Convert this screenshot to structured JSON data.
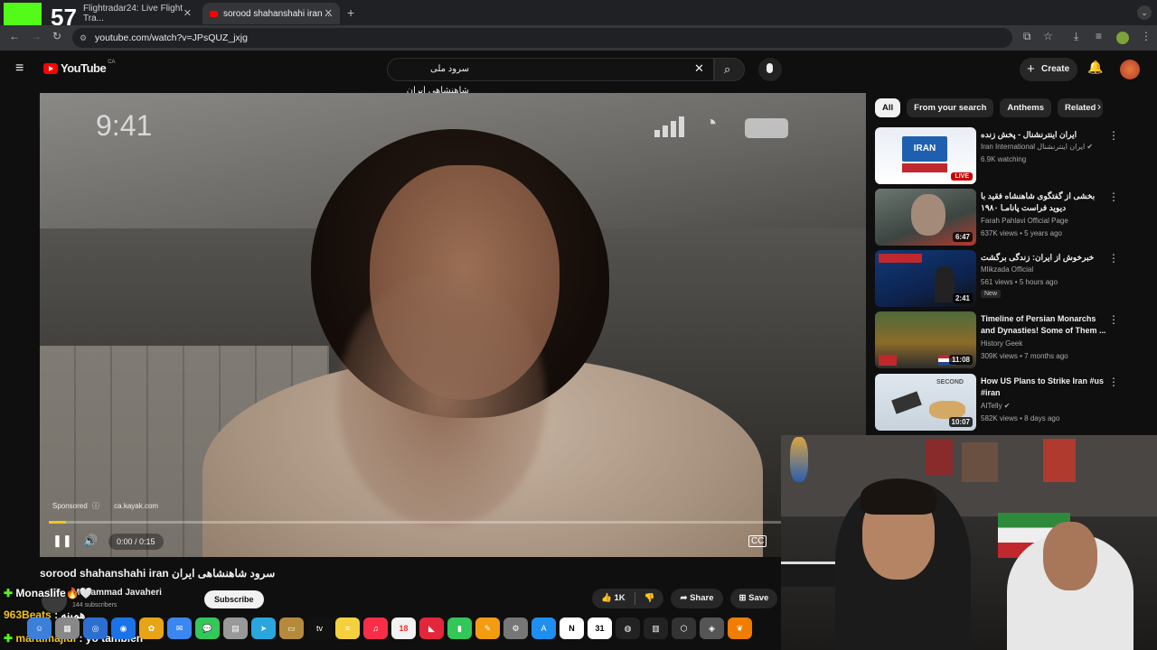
{
  "browser": {
    "tabs": [
      {
        "label": "Flightradar24: Live Flight Tra...",
        "active": false
      },
      {
        "label": "sorood shahanshahi iran ...",
        "active": true
      }
    ],
    "url": "youtube.com/watch?v=JPsQUZ_jxjg"
  },
  "youtube": {
    "logo_text": "YouTube",
    "country_code": "CA",
    "search_query": "سرود ملی شاهنشاهی ایران",
    "create_label": "Create"
  },
  "video": {
    "overlay_clock": "9:41",
    "sponsored_label": "Sponsored",
    "sponsor_domain": "ca.kayak.com",
    "time_display": "0:00 / 0:15",
    "progress_fraction": 0.022,
    "title": "sorood shahanshahi iran سرود شاهنشاهی ایران",
    "channel_name": "Mohammad Javaheri",
    "subscribers": "144 subscribers",
    "subscribe_label": "Subscribe",
    "like_count": "1K",
    "share_label": "Share",
    "save_label": "Save"
  },
  "chips": [
    "All",
    "From your search",
    "Anthems",
    "Related"
  ],
  "recommendations": [
    {
      "title": "ایران اینترنشنال - پخش زنده",
      "channel": "Iran International ایران اینترنشنال",
      "meta": "6.9K watching",
      "badge": "LIVE",
      "verified": true
    },
    {
      "title": "بخشی از گفتگوی شاهنشاه فقید با دیوید فراست پانامـا ۱۹۸۰",
      "channel": "Farah Pahlavi Official Page",
      "meta": "637K views • 5 years ago",
      "duration": "6:47"
    },
    {
      "title": "خبرخوش از ایران: زندگی برگشت",
      "channel": "Mlikzada Official",
      "meta": "561 views • 5 hours ago",
      "duration": "2:41",
      "new_badge": "New"
    },
    {
      "title": "Timeline of Persian Monarchs and Dynasties! Some of Them ...",
      "channel": "History Geek",
      "meta": "309K views • 7 months ago",
      "duration": "11:08"
    },
    {
      "title": "How US Plans to Strike Iran #us #iran",
      "channel": "AITelly",
      "meta": "582K views • 8 days ago",
      "duration": "10:07",
      "verified": true
    }
  ],
  "stream": {
    "viewer_count": "57",
    "chat": [
      {
        "user": "Monaslife",
        "message": "🔥🤍"
      },
      {
        "user": "963Beats",
        "message": ": همینه"
      },
      {
        "user": "maralmajidi",
        "message": ": yo también"
      }
    ]
  },
  "dock": {
    "labels": [
      "tv",
      "18",
      "N",
      "31"
    ]
  },
  "colors": {
    "youtube_red": "#ff0000",
    "kick_green": "#53fc18",
    "progress_yellow": "#f5c518",
    "live_red": "#cc0000"
  }
}
